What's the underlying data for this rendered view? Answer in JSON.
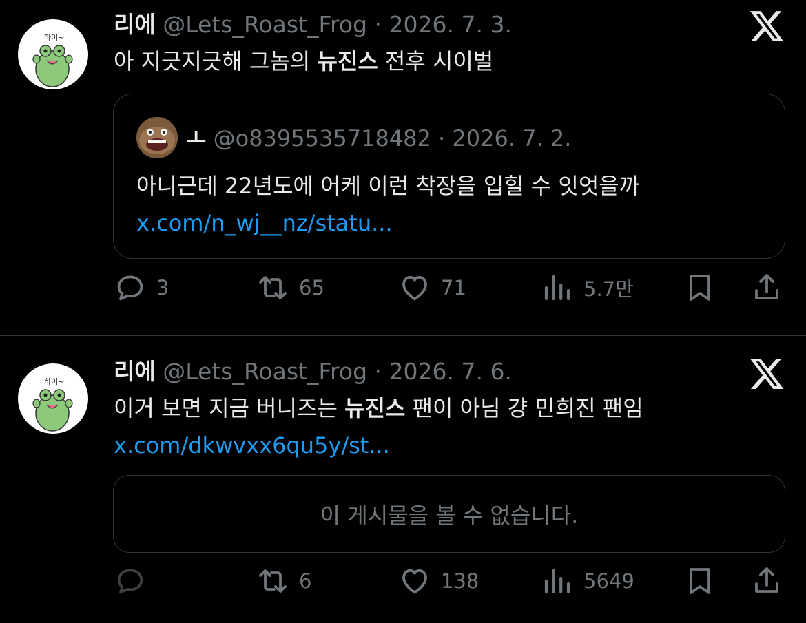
{
  "posts": [
    {
      "name": "리에",
      "handle": "@Lets_Roast_Frog",
      "sep": "·",
      "date": "2026. 7. 3.",
      "avatar_text": "하이~",
      "text_before": "아 지긋지긋해 그놈의 ",
      "text_bold": "뉴진스",
      "text_after": " 전후 시이벌",
      "quote": {
        "name": "ㅗ",
        "handle": "@o8395535718482",
        "sep": "·",
        "date": "2026. 7. 2.",
        "text": "아니근데 22년도에 어케 이런 착장을 입힐 수 잇엇을까",
        "link": "x.com/n_wj__nz/statu..."
      },
      "actions": {
        "replies": "3",
        "reposts": "65",
        "likes": "71",
        "views": "5.7만"
      }
    },
    {
      "name": "리에",
      "handle": "@Lets_Roast_Frog",
      "sep": "·",
      "date": "2026. 7. 6.",
      "avatar_text": "하이~",
      "text_before": "이거 보면 지금 버니즈는 ",
      "text_bold": "뉴진스",
      "text_after": " 팬이 아님 걍 민희진 팬임",
      "link": "x.com/dkwvxx6qu5y/st...",
      "unavailable": "이 게시물을 볼 수 없습니다.",
      "actions": {
        "replies": "",
        "reposts": "6",
        "likes": "138",
        "views": "5649"
      }
    }
  ],
  "colors": {
    "background": "#000000",
    "text": "#e7e9ea",
    "muted": "#71767b",
    "link": "#1d9bf0",
    "border": "#2f3336",
    "frog": "#8cc97a"
  },
  "icons": [
    "x-logo-icon",
    "reply-icon",
    "repost-icon",
    "like-icon",
    "views-icon",
    "bookmark-icon",
    "share-icon"
  ]
}
